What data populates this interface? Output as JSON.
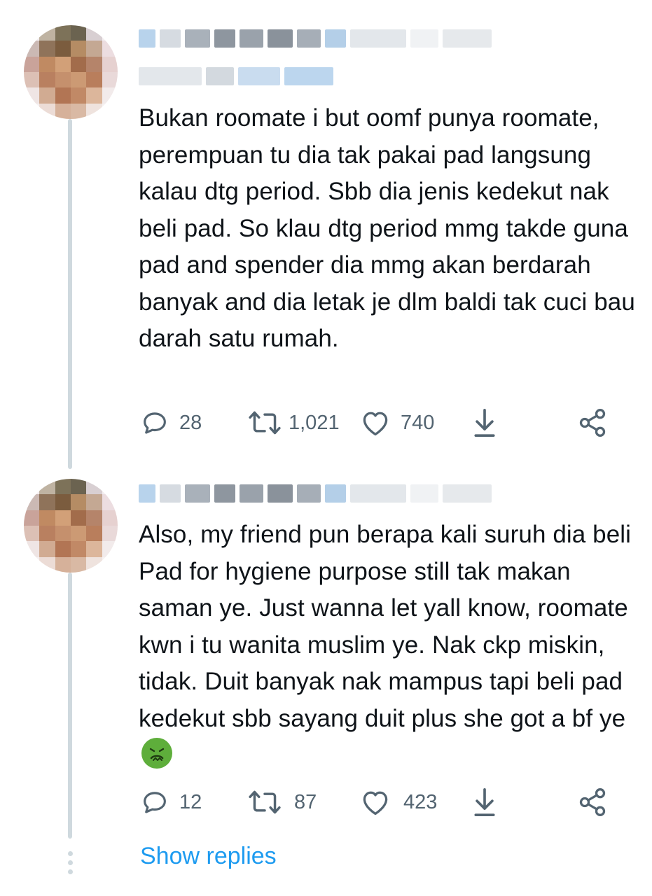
{
  "tweets": [
    {
      "text": "Bukan roomate i but oomf punya roomate, perempuan tu dia tak pakai pad langsung kalau dtg period. Sbb dia jenis kedekut nak beli pad. So klau dtg period mmg takde guna pad and spender dia mmg akan berdarah banyak and dia letak je dlm baldi tak cuci bau darah satu rumah.",
      "replies": "28",
      "retweets": "1,021",
      "likes": "740"
    },
    {
      "text": "Also, my friend pun berapa kali suruh dia beli Pad for hygiene purpose still tak makan saman ye. Just wanna let yall know, roomate kwn i tu wanita muslim ye. Nak ckp miskin, tidak. Duit banyak nak mampus tapi beli pad kedekut sbb sayang duit plus she got a bf ye",
      "emoji": "nauseated-face",
      "replies": "12",
      "retweets": "87",
      "likes": "423"
    }
  ],
  "show_replies_label": "Show replies",
  "colors": {
    "text": "#0f1419",
    "muted": "#536471",
    "link": "#1d9bf0",
    "thread_line": "#cfd9de",
    "emoji": "#5eae3b"
  }
}
